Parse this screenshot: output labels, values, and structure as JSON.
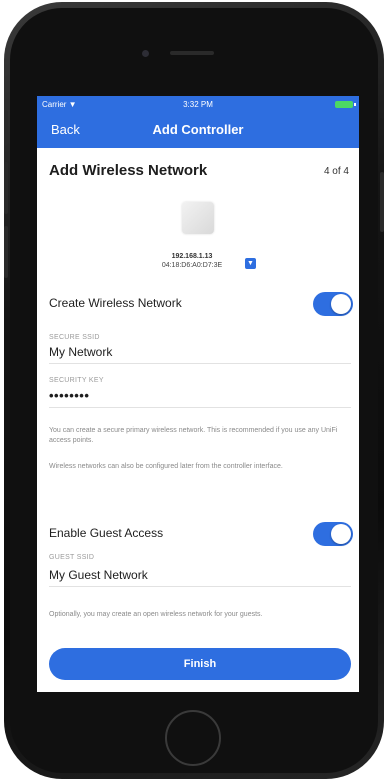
{
  "status_bar": {
    "carrier": "Carrier ▼",
    "time": "3:32 PM"
  },
  "nav": {
    "back_label": "Back",
    "title": "Add Controller"
  },
  "page": {
    "title": "Add Wireless Network",
    "step": "4 of 4"
  },
  "device": {
    "ip": "192.168.1.13",
    "mac": "04:18:D6:A0:D7:3E",
    "icon": "dropdown-icon"
  },
  "wireless": {
    "toggle_label": "Create Wireless Network",
    "enabled": true,
    "ssid_caption": "SECURE SSID",
    "ssid_value": "My Network",
    "key_caption": "SECURITY KEY",
    "key_value": "••••••••",
    "help_1": "You can create a secure primary wireless network. This is recommended if you use any UniFi access points.",
    "help_2": "Wireless networks can also be configured later from the controller interface."
  },
  "guest": {
    "toggle_label": "Enable Guest Access",
    "enabled": true,
    "ssid_caption": "GUEST SSID",
    "ssid_value": "My Guest Network",
    "help": "Optionally, you may create an open wireless network for your guests."
  },
  "finish_label": "Finish",
  "colors": {
    "accent": "#2e6ee0",
    "battery": "#4cd964"
  }
}
